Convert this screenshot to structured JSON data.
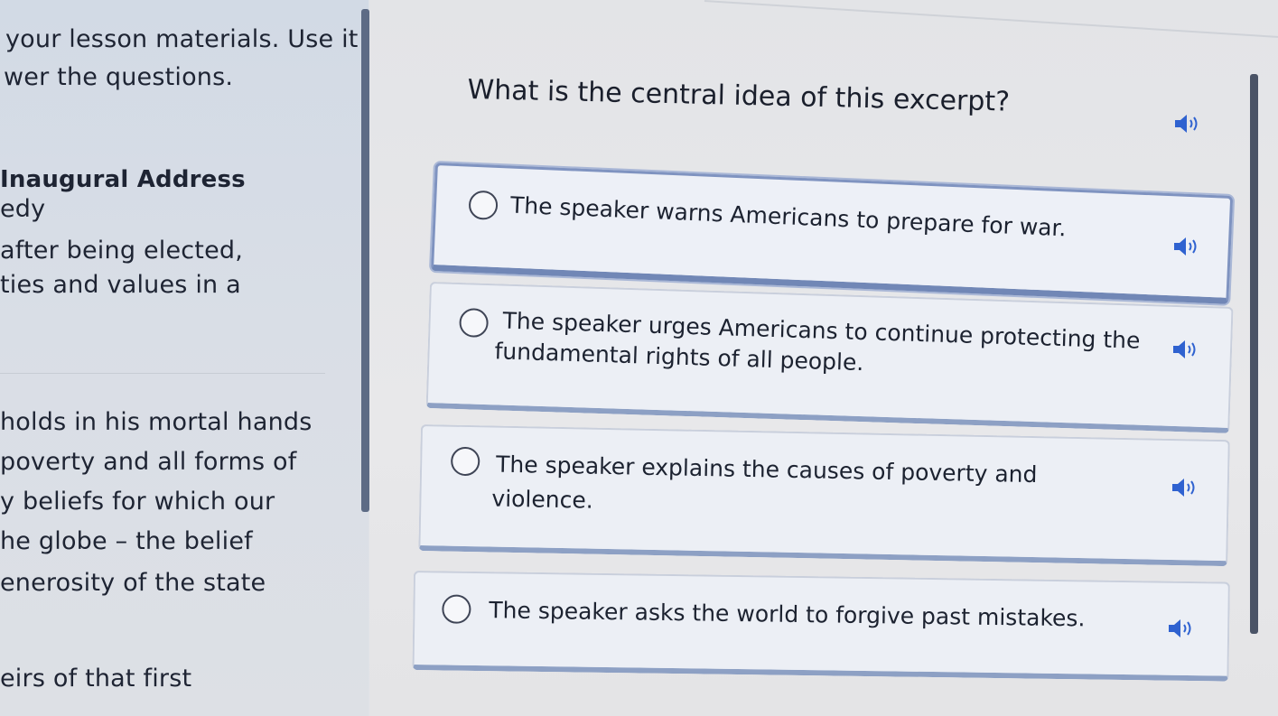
{
  "passage": {
    "lines": [
      "your lesson materials. Use it",
      "wer the questions.",
      "Inaugural Address",
      "edy",
      "after being elected,",
      "ties and values in a",
      "holds in his mortal hands",
      "poverty and all forms of",
      "y beliefs for which our",
      "he globe – the belief",
      "enerosity of the state",
      "eirs of that first"
    ]
  },
  "question": {
    "text": "What is the central idea of this excerpt?",
    "audio_icon": "speaker-icon"
  },
  "options": [
    {
      "line1": "The speaker warns Americans to prepare for war.",
      "line2": "",
      "selected": true
    },
    {
      "line1": "The speaker urges Americans to continue protecting the",
      "line2": "fundamental rights of all people.",
      "selected": false
    },
    {
      "line1": "The speaker explains the causes of poverty and",
      "line2": "violence.",
      "selected": false
    },
    {
      "line1": "The speaker asks the world to forgive past mistakes.",
      "line2": "",
      "selected": false
    }
  ],
  "colors": {
    "accent": "#8da0c4",
    "selected_border": "#7f93c0",
    "speaker": "#2f62d0"
  }
}
